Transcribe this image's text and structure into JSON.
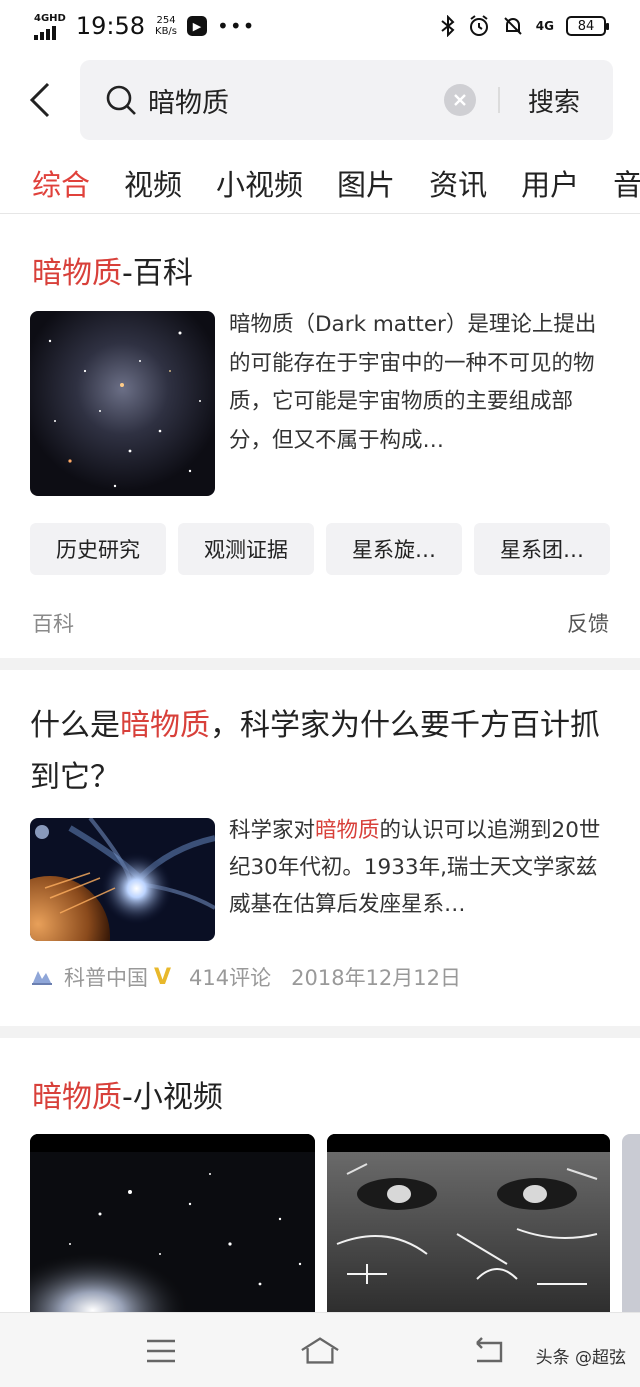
{
  "status_bar": {
    "network": "4G",
    "network_sub": "HD",
    "time": "19:58",
    "speed_value": "254",
    "speed_unit": "KB/s",
    "battery": "84",
    "right_net": "4G"
  },
  "search": {
    "query": "暗物质",
    "button_label": "搜索"
  },
  "tabs": [
    "综合",
    "视频",
    "小视频",
    "图片",
    "资讯",
    "用户",
    "音"
  ],
  "card_wiki": {
    "title_highlight": "暗物质",
    "title_rest": "-百科",
    "description": "暗物质（Dark matter）是理论上提出的可能存在于宇宙中的一种不可见的物质，它可能是宇宙物质的主要组成部分，但又不属于构成…",
    "chips": [
      "历史研究",
      "观测证据",
      "星系旋…",
      "星系团…"
    ],
    "source": "百科",
    "feedback": "反馈"
  },
  "card_article": {
    "title_prefix": "什么是",
    "title_highlight": "暗物质",
    "title_suffix": "，科学家为什么要千方百计抓到它？",
    "desc_prefix": "科学家对",
    "desc_highlight": "暗物质",
    "desc_suffix": "的认识可以追溯到20世纪30年代初。1933年,瑞士天文学家兹威基在估算后发座星系…",
    "author": "科普中国",
    "verified_mark": "V",
    "comments": "414评论",
    "date": "2018年12月12日"
  },
  "card_video": {
    "title_highlight": "暗物质",
    "title_rest": "-小视频"
  },
  "watermark": "头条 @超弦",
  "colors": {
    "accent": "#e0413b",
    "chip_bg": "#f2f2f4",
    "verified": "#e8b82b"
  }
}
